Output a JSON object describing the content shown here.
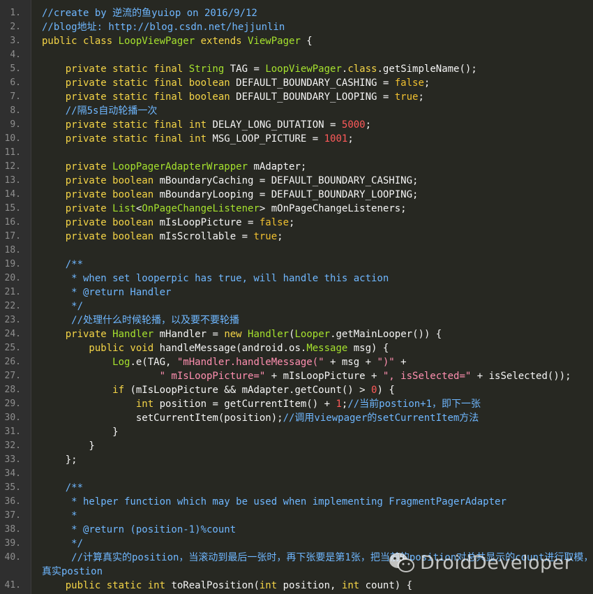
{
  "watermark": {
    "text": "DroidDeveloper",
    "icon": "wechat-icon"
  },
  "colors": {
    "background": "#272822",
    "keyword": "#f5d547",
    "type": "#a6e22e",
    "string": "#ff8fb0",
    "number": "#ff5a5a",
    "comment": "#6fb7ff",
    "plain": "#f5f5f5",
    "line_number": "#8f8f8f"
  },
  "lines": [
    {
      "n": "1.",
      "tokens": [
        [
          "c",
          "//create by 逆流的鱼yuiop on 2016/9/12"
        ]
      ]
    },
    {
      "n": "2.",
      "tokens": [
        [
          "c",
          "//blog地址: http://blog.csdn.net/hejjunlin"
        ]
      ]
    },
    {
      "n": "3.",
      "tokens": [
        [
          "k",
          "public class "
        ],
        [
          "t",
          "LoopViewPager"
        ],
        [
          "k",
          " extends "
        ],
        [
          "t",
          "ViewPager"
        ],
        [
          "p",
          " {"
        ]
      ]
    },
    {
      "n": "4.",
      "tokens": []
    },
    {
      "n": "5.",
      "tokens": [
        [
          "k",
          "    private static final "
        ],
        [
          "t",
          "String"
        ],
        [
          "p",
          " TAG = "
        ],
        [
          "t",
          "LoopViewPager"
        ],
        [
          "p",
          "."
        ],
        [
          "k",
          "class"
        ],
        [
          "p",
          ".getSimpleName();"
        ]
      ]
    },
    {
      "n": "6.",
      "tokens": [
        [
          "k",
          "    private static final boolean"
        ],
        [
          "p",
          " DEFAULT_BOUNDARY_CASHING = "
        ],
        [
          "b",
          "false"
        ],
        [
          "p",
          ";"
        ]
      ]
    },
    {
      "n": "7.",
      "tokens": [
        [
          "k",
          "    private static final boolean"
        ],
        [
          "p",
          " DEFAULT_BOUNDARY_LOOPING = "
        ],
        [
          "b",
          "true"
        ],
        [
          "p",
          ";"
        ]
      ]
    },
    {
      "n": "8.",
      "tokens": [
        [
          "c",
          "    //隔5s自动轮播一次"
        ]
      ]
    },
    {
      "n": "9.",
      "tokens": [
        [
          "k",
          "    private static final int"
        ],
        [
          "p",
          " DELAY_LONG_DUTATION = "
        ],
        [
          "n",
          "5000"
        ],
        [
          "p",
          ";"
        ]
      ]
    },
    {
      "n": "10.",
      "tokens": [
        [
          "k",
          "    private static final int"
        ],
        [
          "p",
          " MSG_LOOP_PICTURE = "
        ],
        [
          "n",
          "1001"
        ],
        [
          "p",
          ";"
        ]
      ]
    },
    {
      "n": "11.",
      "tokens": []
    },
    {
      "n": "12.",
      "tokens": [
        [
          "k",
          "    private "
        ],
        [
          "t",
          "LoopPagerAdapterWrapper"
        ],
        [
          "p",
          " mAdapter;"
        ]
      ]
    },
    {
      "n": "13.",
      "tokens": [
        [
          "k",
          "    private boolean"
        ],
        [
          "p",
          " mBoundaryCaching = DEFAULT_BOUNDARY_CASHING;"
        ]
      ]
    },
    {
      "n": "14.",
      "tokens": [
        [
          "k",
          "    private boolean"
        ],
        [
          "p",
          " mBoundaryLooping = DEFAULT_BOUNDARY_LOOPING;"
        ]
      ]
    },
    {
      "n": "15.",
      "tokens": [
        [
          "k",
          "    private "
        ],
        [
          "t",
          "List"
        ],
        [
          "p",
          "<"
        ],
        [
          "t",
          "OnPageChangeListener"
        ],
        [
          "p",
          "> mOnPageChangeListeners;"
        ]
      ]
    },
    {
      "n": "16.",
      "tokens": [
        [
          "k",
          "    private boolean"
        ],
        [
          "p",
          " mIsLoopPicture = "
        ],
        [
          "b",
          "false"
        ],
        [
          "p",
          ";"
        ]
      ]
    },
    {
      "n": "17.",
      "tokens": [
        [
          "k",
          "    private boolean"
        ],
        [
          "p",
          " mIsScrollable = "
        ],
        [
          "b",
          "true"
        ],
        [
          "p",
          ";"
        ]
      ]
    },
    {
      "n": "18.",
      "tokens": []
    },
    {
      "n": "19.",
      "tokens": [
        [
          "c",
          "    /**"
        ]
      ]
    },
    {
      "n": "20.",
      "tokens": [
        [
          "c",
          "     * when set looperpic has true, will handle this action"
        ]
      ]
    },
    {
      "n": "21.",
      "tokens": [
        [
          "c",
          "     * @return Handler"
        ]
      ]
    },
    {
      "n": "22.",
      "tokens": [
        [
          "c",
          "     */"
        ]
      ]
    },
    {
      "n": "23.",
      "tokens": [
        [
          "c",
          "     //处理什么时候轮播，以及要不要轮播"
        ]
      ]
    },
    {
      "n": "24.",
      "tokens": [
        [
          "k",
          "    private "
        ],
        [
          "t",
          "Handler"
        ],
        [
          "p",
          " mHandler = "
        ],
        [
          "k",
          "new "
        ],
        [
          "t",
          "Handler"
        ],
        [
          "p",
          "("
        ],
        [
          "t",
          "Looper"
        ],
        [
          "p",
          ".getMainLooper()) {"
        ]
      ]
    },
    {
      "n": "25.",
      "tokens": [
        [
          "k",
          "        public void"
        ],
        [
          "p",
          " handleMessage(android.os."
        ],
        [
          "t",
          "Message"
        ],
        [
          "p",
          " msg) {"
        ]
      ]
    },
    {
      "n": "26.",
      "tokens": [
        [
          "t",
          "            Log"
        ],
        [
          "p",
          ".e(TAG, "
        ],
        [
          "s",
          "\"mHandler.handleMessage(\""
        ],
        [
          "p",
          " + msg + "
        ],
        [
          "s",
          "\")\""
        ],
        [
          "p",
          " +"
        ]
      ]
    },
    {
      "n": "27.",
      "tokens": [
        [
          "s",
          "                    \" mIsLoopPicture=\""
        ],
        [
          "p",
          " + mIsLoopPicture + "
        ],
        [
          "s",
          "\", isSelected=\""
        ],
        [
          "p",
          " + isSelected());"
        ]
      ]
    },
    {
      "n": "28.",
      "tokens": [
        [
          "k",
          "            if"
        ],
        [
          "p",
          " (mIsLoopPicture && mAdapter.getCount() > "
        ],
        [
          "n",
          "0"
        ],
        [
          "p",
          ") {"
        ]
      ]
    },
    {
      "n": "29.",
      "tokens": [
        [
          "k",
          "                int"
        ],
        [
          "p",
          " position = getCurrentItem() + "
        ],
        [
          "n",
          "1"
        ],
        [
          "p",
          ";"
        ],
        [
          "c",
          "//当前postion+1，即下一张"
        ]
      ]
    },
    {
      "n": "30.",
      "tokens": [
        [
          "p",
          "                setCurrentItem(position);"
        ],
        [
          "c",
          "//调用viewpager的setCurrentItem方法"
        ]
      ]
    },
    {
      "n": "31.",
      "tokens": [
        [
          "p",
          "            }"
        ]
      ]
    },
    {
      "n": "32.",
      "tokens": [
        [
          "p",
          "        }"
        ]
      ]
    },
    {
      "n": "33.",
      "tokens": [
        [
          "p",
          "    };"
        ]
      ]
    },
    {
      "n": "34.",
      "tokens": []
    },
    {
      "n": "35.",
      "tokens": [
        [
          "c",
          "    /**"
        ]
      ]
    },
    {
      "n": "36.",
      "tokens": [
        [
          "c",
          "     * helper function which may be used when implementing FragmentPagerAdapter"
        ]
      ]
    },
    {
      "n": "37.",
      "tokens": [
        [
          "c",
          "     *"
        ]
      ]
    },
    {
      "n": "38.",
      "tokens": [
        [
          "c",
          "     * @return (position-1)%count"
        ]
      ]
    },
    {
      "n": "39.",
      "tokens": [
        [
          "c",
          "     */"
        ]
      ]
    },
    {
      "n": "40.",
      "tokens": [
        [
          "c",
          "     //计算真实的position，当滚动到最后一张时，再下张要是第1张，把当前的position对总共显示的count进行取模，即得"
        ]
      ]
    },
    {
      "n": "",
      "tokens": [
        [
          "c",
          "真实postion"
        ]
      ]
    },
    {
      "n": "41.",
      "tokens": [
        [
          "k",
          "    public static int"
        ],
        [
          "p",
          " toRealPosition("
        ],
        [
          "k",
          "int"
        ],
        [
          "p",
          " position, "
        ],
        [
          "k",
          "int"
        ],
        [
          "p",
          " count) {"
        ]
      ]
    }
  ]
}
